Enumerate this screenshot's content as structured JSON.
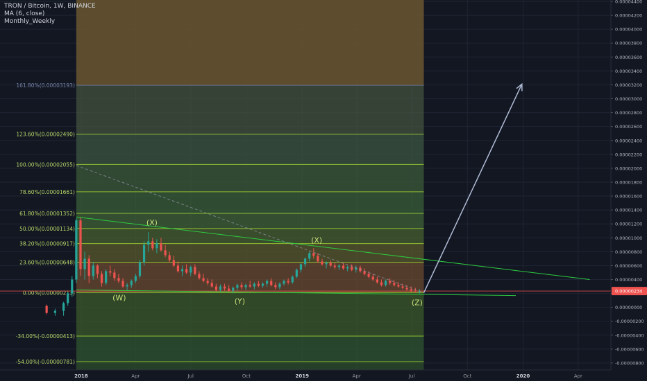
{
  "legend": {
    "title": "TRON / Bitcoin, 1W, BINANCE",
    "indicator1": "MA (6, close)",
    "indicator2": "Monthly_Weekly"
  },
  "colors": {
    "background": "#131722",
    "grid": "#1e2433",
    "up": "#26a69a",
    "down": "#ef5350",
    "fib": "#9acd32",
    "trend": "#2ecc40",
    "price_tag": "#ef5350",
    "arrow": "#b0bcd6"
  },
  "chart_data": {
    "type": "candlestick",
    "y_ticks": [
      "0.00004400",
      "0.00004200",
      "0.00004000",
      "0.00003800",
      "0.00003600",
      "0.00003400",
      "0.00003200",
      "0.00003000",
      "0.00002800",
      "0.00002600",
      "0.00002400",
      "0.00002200",
      "0.00002000",
      "0.00001800",
      "0.00001600",
      "0.00001400",
      "0.00001200",
      "0.00001000",
      "0.00000800",
      "0.00000600",
      "0.00000400",
      "0.00000200",
      "0.00000000",
      "-0.00000200",
      "-0.00000400",
      "-0.00000600",
      "-0.00000800"
    ],
    "ylim": [
      -9e-06,
      4.42e-05
    ],
    "x_ticks": [
      {
        "label": "2018",
        "date": "2018-01-01",
        "bold": true
      },
      {
        "label": "Apr",
        "date": "2018-04-01"
      },
      {
        "label": "Jul",
        "date": "2018-07-01"
      },
      {
        "label": "Oct",
        "date": "2018-10-01"
      },
      {
        "label": "2019",
        "date": "2019-01-01",
        "bold": true
      },
      {
        "label": "Apr",
        "date": "2019-04-01"
      },
      {
        "label": "Jul",
        "date": "2019-07-01"
      },
      {
        "label": "Oct",
        "date": "2019-10-01"
      },
      {
        "label": "2020",
        "date": "2020-01-01",
        "bold": true
      },
      {
        "label": "Apr",
        "date": "2020-04-01"
      }
    ],
    "xlim": [
      "2017-08-20",
      "2020-05-25"
    ],
    "last_price": "0.00000234",
    "last_price_value": 2.34e-06,
    "fib_range": [
      "2017-12-24",
      "2019-07-21"
    ],
    "fib_levels": [
      {
        "label": "161.80%(0.00003193)",
        "value": 3.193e-05
      },
      {
        "label": "123.60%(0.00002490)",
        "value": 2.49e-05
      },
      {
        "label": "100.00%(0.00002055)",
        "value": 2.055e-05
      },
      {
        "label": "78.60%(0.00001661)",
        "value": 1.661e-05
      },
      {
        "label": "61.80%(0.00001352)",
        "value": 1.352e-05
      },
      {
        "label": "50.00%(0.00001134)",
        "value": 1.134e-05
      },
      {
        "label": "38.20%(0.00000917)",
        "value": 9.17e-06
      },
      {
        "label": "23.60%(0.00000648)",
        "value": 6.48e-06
      },
      {
        "label": "0.00%(0.00000213)",
        "value": 2.13e-06
      },
      {
        "label": "-34.00%(-0.00000413)",
        "value": -4.13e-06
      },
      {
        "label": "-54.00%(-0.00000781)",
        "value": -7.81e-06
      }
    ],
    "wave_labels": [
      {
        "text": "(X)",
        "date": "2018-04-28",
        "value": 1.18e-05
      },
      {
        "text": "(W)",
        "date": "2018-03-05",
        "value": 1e-06
      },
      {
        "text": "(Y)",
        "date": "2018-09-20",
        "value": 5e-07
      },
      {
        "text": "(X)",
        "date": "2019-01-25",
        "value": 9.3e-06
      },
      {
        "text": "(Z)",
        "date": "2019-07-10",
        "value": 3e-07
      }
    ],
    "trendlines": [
      {
        "from": [
          "2017-12-24",
          1.3e-05
        ],
        "to": [
          "2020-04-20",
          4e-06
        ],
        "color": "trend"
      },
      {
        "from": [
          "2017-12-24",
          2.5e-06
        ],
        "to": [
          "2019-12-20",
          1.7e-06
        ],
        "color": "trend"
      },
      {
        "from": [
          "2017-12-24",
          2.04e-05
        ],
        "to": [
          "2019-07-21",
          2.1e-06
        ],
        "color": "dash"
      },
      {
        "from": [
          "2019-07-21",
          2.1e-06
        ],
        "to": [
          "2019-12-30",
          3.21e-05
        ],
        "color": "arrow"
      }
    ],
    "candles": [
      {
        "date": "2017-11-05",
        "o": 2e-07,
        "h": 4e-07,
        "l": -1e-06,
        "c": -8e-07
      },
      {
        "date": "2017-11-19",
        "o": -8e-07,
        "h": -2e-07,
        "l": -1.2e-06,
        "c": -5e-07
      },
      {
        "date": "2017-12-03",
        "o": -5e-07,
        "h": 8e-07,
        "l": -1.2e-06,
        "c": 6e-07
      },
      {
        "date": "2017-12-10",
        "o": 6e-07,
        "h": 2.2e-06,
        "l": 2e-07,
        "c": 2e-06
      },
      {
        "date": "2017-12-17",
        "o": 2e-06,
        "h": 4.5e-06,
        "l": 1.5e-06,
        "c": 4e-06
      },
      {
        "date": "2017-12-24",
        "o": 4e-06,
        "h": 1.28e-05,
        "l": 3.5e-06,
        "c": 1.25e-05
      },
      {
        "date": "2017-12-31",
        "o": 1.25e-05,
        "h": 1.3e-05,
        "l": 4.5e-06,
        "c": 5.5e-06
      },
      {
        "date": "2018-01-07",
        "o": 5.5e-06,
        "h": 8e-06,
        "l": 4e-06,
        "c": 7e-06
      },
      {
        "date": "2018-01-14",
        "o": 7e-06,
        "h": 7.5e-06,
        "l": 3.5e-06,
        "c": 4.5e-06
      },
      {
        "date": "2018-01-21",
        "o": 4.5e-06,
        "h": 6.5e-06,
        "l": 4e-06,
        "c": 6e-06
      },
      {
        "date": "2018-01-28",
        "o": 6e-06,
        "h": 6.2e-06,
        "l": 4.2e-06,
        "c": 4.8e-06
      },
      {
        "date": "2018-02-04",
        "o": 4.8e-06,
        "h": 5.2e-06,
        "l": 3e-06,
        "c": 3.5e-06
      },
      {
        "date": "2018-02-11",
        "o": 3.5e-06,
        "h": 5.5e-06,
        "l": 3.2e-06,
        "c": 5.2e-06
      },
      {
        "date": "2018-02-18",
        "o": 5.2e-06,
        "h": 6e-06,
        "l": 4.5e-06,
        "c": 5e-06
      },
      {
        "date": "2018-02-25",
        "o": 5e-06,
        "h": 5.5e-06,
        "l": 3.8e-06,
        "c": 4.2e-06
      },
      {
        "date": "2018-03-04",
        "o": 4.2e-06,
        "h": 4.8e-06,
        "l": 3.5e-06,
        "c": 3.8e-06
      },
      {
        "date": "2018-03-11",
        "o": 3.8e-06,
        "h": 4.2e-06,
        "l": 2.8e-06,
        "c": 3e-06
      },
      {
        "date": "2018-03-18",
        "o": 3e-06,
        "h": 3.5e-06,
        "l": 2.5e-06,
        "c": 3.2e-06
      },
      {
        "date": "2018-03-25",
        "o": 3.2e-06,
        "h": 4e-06,
        "l": 2.8e-06,
        "c": 3.8e-06
      },
      {
        "date": "2018-04-01",
        "o": 3.8e-06,
        "h": 4.8e-06,
        "l": 3.5e-06,
        "c": 4.5e-06
      },
      {
        "date": "2018-04-08",
        "o": 4.5e-06,
        "h": 6.8e-06,
        "l": 4.2e-06,
        "c": 6.5e-06
      },
      {
        "date": "2018-04-15",
        "o": 6.5e-06,
        "h": 9.5e-06,
        "l": 6e-06,
        "c": 9e-06
      },
      {
        "date": "2018-04-22",
        "o": 9e-06,
        "h": 1.08e-05,
        "l": 8e-06,
        "c": 9.5e-06
      },
      {
        "date": "2018-04-29",
        "o": 9.5e-06,
        "h": 1e-05,
        "l": 8.2e-06,
        "c": 8.5e-06
      },
      {
        "date": "2018-05-06",
        "o": 8.5e-06,
        "h": 9.8e-06,
        "l": 7.8e-06,
        "c": 9.2e-06
      },
      {
        "date": "2018-05-13",
        "o": 9.2e-06,
        "h": 1e-05,
        "l": 8e-06,
        "c": 8.2e-06
      },
      {
        "date": "2018-05-20",
        "o": 8.2e-06,
        "h": 9e-06,
        "l": 7.2e-06,
        "c": 7.5e-06
      },
      {
        "date": "2018-05-27",
        "o": 7.5e-06,
        "h": 8e-06,
        "l": 6.5e-06,
        "c": 6.8e-06
      },
      {
        "date": "2018-06-03",
        "o": 6.8e-06,
        "h": 7.4e-06,
        "l": 5.8e-06,
        "c": 6e-06
      },
      {
        "date": "2018-06-10",
        "o": 6e-06,
        "h": 6.6e-06,
        "l": 5e-06,
        "c": 5.2e-06
      },
      {
        "date": "2018-06-17",
        "o": 5.2e-06,
        "h": 6e-06,
        "l": 4.5e-06,
        "c": 5.5e-06
      },
      {
        "date": "2018-06-24",
        "o": 5.5e-06,
        "h": 6.2e-06,
        "l": 4.8e-06,
        "c": 5e-06
      },
      {
        "date": "2018-07-01",
        "o": 5e-06,
        "h": 6e-06,
        "l": 4.5e-06,
        "c": 5.8e-06
      },
      {
        "date": "2018-07-08",
        "o": 5.8e-06,
        "h": 6.2e-06,
        "l": 4.6e-06,
        "c": 4.8e-06
      },
      {
        "date": "2018-07-15",
        "o": 4.8e-06,
        "h": 5.2e-06,
        "l": 4e-06,
        "c": 4.2e-06
      },
      {
        "date": "2018-07-22",
        "o": 4.2e-06,
        "h": 4.8e-06,
        "l": 3.6e-06,
        "c": 3.8e-06
      },
      {
        "date": "2018-07-29",
        "o": 3.8e-06,
        "h": 4.2e-06,
        "l": 3.2e-06,
        "c": 3.5e-06
      },
      {
        "date": "2018-08-05",
        "o": 3.5e-06,
        "h": 4e-06,
        "l": 2.8e-06,
        "c": 3e-06
      },
      {
        "date": "2018-08-12",
        "o": 3e-06,
        "h": 3.4e-06,
        "l": 2.2e-06,
        "c": 2.5e-06
      },
      {
        "date": "2018-08-19",
        "o": 2.5e-06,
        "h": 3.3e-06,
        "l": 2.2e-06,
        "c": 3e-06
      },
      {
        "date": "2018-08-26",
        "o": 3e-06,
        "h": 3.4e-06,
        "l": 2.4e-06,
        "c": 2.7e-06
      },
      {
        "date": "2018-09-02",
        "o": 2.7e-06,
        "h": 3.2e-06,
        "l": 2.2e-06,
        "c": 2.4e-06
      },
      {
        "date": "2018-09-09",
        "o": 2.4e-06,
        "h": 3e-06,
        "l": 2e-06,
        "c": 2.8e-06
      },
      {
        "date": "2018-09-16",
        "o": 2.8e-06,
        "h": 3.4e-06,
        "l": 2.4e-06,
        "c": 3.2e-06
      },
      {
        "date": "2018-09-23",
        "o": 3.2e-06,
        "h": 3.6e-06,
        "l": 2.6e-06,
        "c": 2.9e-06
      },
      {
        "date": "2018-09-30",
        "o": 2.9e-06,
        "h": 3.4e-06,
        "l": 2.5e-06,
        "c": 3.2e-06
      },
      {
        "date": "2018-10-07",
        "o": 3.2e-06,
        "h": 3.8e-06,
        "l": 2.8e-06,
        "c": 3e-06
      },
      {
        "date": "2018-10-14",
        "o": 3e-06,
        "h": 3.6e-06,
        "l": 2.6e-06,
        "c": 3.4e-06
      },
      {
        "date": "2018-10-21",
        "o": 3.4e-06,
        "h": 3.8e-06,
        "l": 2.9e-06,
        "c": 3.1e-06
      },
      {
        "date": "2018-10-28",
        "o": 3.1e-06,
        "h": 3.6e-06,
        "l": 2.8e-06,
        "c": 3.4e-06
      },
      {
        "date": "2018-11-04",
        "o": 3.4e-06,
        "h": 4e-06,
        "l": 3e-06,
        "c": 3.8e-06
      },
      {
        "date": "2018-11-11",
        "o": 3.8e-06,
        "h": 4.2e-06,
        "l": 3e-06,
        "c": 3.2e-06
      },
      {
        "date": "2018-11-18",
        "o": 3.2e-06,
        "h": 3.6e-06,
        "l": 2.6e-06,
        "c": 2.9e-06
      },
      {
        "date": "2018-11-25",
        "o": 2.9e-06,
        "h": 3.6e-06,
        "l": 2.6e-06,
        "c": 3.4e-06
      },
      {
        "date": "2018-12-02",
        "o": 3.4e-06,
        "h": 4e-06,
        "l": 3.1e-06,
        "c": 3.8e-06
      },
      {
        "date": "2018-12-09",
        "o": 3.8e-06,
        "h": 4.2e-06,
        "l": 3.3e-06,
        "c": 3.6e-06
      },
      {
        "date": "2018-12-16",
        "o": 3.6e-06,
        "h": 4.6e-06,
        "l": 3.4e-06,
        "c": 4.4e-06
      },
      {
        "date": "2018-12-23",
        "o": 4.4e-06,
        "h": 5.6e-06,
        "l": 4.2e-06,
        "c": 5.4e-06
      },
      {
        "date": "2018-12-30",
        "o": 5.4e-06,
        "h": 6.4e-06,
        "l": 5e-06,
        "c": 6.2e-06
      },
      {
        "date": "2019-01-06",
        "o": 6.2e-06,
        "h": 7.2e-06,
        "l": 5.8e-06,
        "c": 7e-06
      },
      {
        "date": "2019-01-13",
        "o": 7e-06,
        "h": 8e-06,
        "l": 6.6e-06,
        "c": 7.8e-06
      },
      {
        "date": "2019-01-20",
        "o": 7.8e-06,
        "h": 8.5e-06,
        "l": 7e-06,
        "c": 7.4e-06
      },
      {
        "date": "2019-01-27",
        "o": 7.4e-06,
        "h": 7.8e-06,
        "l": 6.4e-06,
        "c": 6.6e-06
      },
      {
        "date": "2019-02-03",
        "o": 6.6e-06,
        "h": 7e-06,
        "l": 6e-06,
        "c": 6.2e-06
      },
      {
        "date": "2019-02-10",
        "o": 6.2e-06,
        "h": 6.6e-06,
        "l": 5.6e-06,
        "c": 6.4e-06
      },
      {
        "date": "2019-02-17",
        "o": 6.4e-06,
        "h": 6.8e-06,
        "l": 5.8e-06,
        "c": 6e-06
      },
      {
        "date": "2019-02-24",
        "o": 6e-06,
        "h": 6.4e-06,
        "l": 5.5e-06,
        "c": 5.8e-06
      },
      {
        "date": "2019-03-03",
        "o": 5.8e-06,
        "h": 6.2e-06,
        "l": 5.4e-06,
        "c": 6e-06
      },
      {
        "date": "2019-03-10",
        "o": 6e-06,
        "h": 6.4e-06,
        "l": 5.4e-06,
        "c": 5.6e-06
      },
      {
        "date": "2019-03-17",
        "o": 5.6e-06,
        "h": 6e-06,
        "l": 5.2e-06,
        "c": 5.8e-06
      },
      {
        "date": "2019-03-24",
        "o": 5.8e-06,
        "h": 6.2e-06,
        "l": 5.2e-06,
        "c": 5.4e-06
      },
      {
        "date": "2019-03-31",
        "o": 5.4e-06,
        "h": 6e-06,
        "l": 5e-06,
        "c": 5.7e-06
      },
      {
        "date": "2019-04-07",
        "o": 5.7e-06,
        "h": 6e-06,
        "l": 5e-06,
        "c": 5.2e-06
      },
      {
        "date": "2019-04-14",
        "o": 5.2e-06,
        "h": 5.6e-06,
        "l": 4.6e-06,
        "c": 4.8e-06
      },
      {
        "date": "2019-04-21",
        "o": 4.8e-06,
        "h": 5.2e-06,
        "l": 4.2e-06,
        "c": 4.4e-06
      },
      {
        "date": "2019-04-28",
        "o": 4.4e-06,
        "h": 4.8e-06,
        "l": 3.8e-06,
        "c": 4e-06
      },
      {
        "date": "2019-05-05",
        "o": 4e-06,
        "h": 4.4e-06,
        "l": 3.4e-06,
        "c": 3.6e-06
      },
      {
        "date": "2019-05-12",
        "o": 3.6e-06,
        "h": 4e-06,
        "l": 3e-06,
        "c": 3.2e-06
      },
      {
        "date": "2019-05-19",
        "o": 3.2e-06,
        "h": 4e-06,
        "l": 3e-06,
        "c": 3.8e-06
      },
      {
        "date": "2019-05-26",
        "o": 3.8e-06,
        "h": 4.2e-06,
        "l": 3.2e-06,
        "c": 3.5e-06
      },
      {
        "date": "2019-06-02",
        "o": 3.5e-06,
        "h": 3.9e-06,
        "l": 3e-06,
        "c": 3.2e-06
      },
      {
        "date": "2019-06-09",
        "o": 3.2e-06,
        "h": 3.6e-06,
        "l": 2.8e-06,
        "c": 3e-06
      },
      {
        "date": "2019-06-16",
        "o": 3e-06,
        "h": 3.4e-06,
        "l": 2.6e-06,
        "c": 2.8e-06
      },
      {
        "date": "2019-06-23",
        "o": 2.8e-06,
        "h": 3.2e-06,
        "l": 2.4e-06,
        "c": 2.6e-06
      },
      {
        "date": "2019-06-30",
        "o": 2.6e-06,
        "h": 3e-06,
        "l": 2.2e-06,
        "c": 2.4e-06
      },
      {
        "date": "2019-07-07",
        "o": 2.4e-06,
        "h": 2.8e-06,
        "l": 2.1e-06,
        "c": 2.3e-06
      },
      {
        "date": "2019-07-14",
        "o": 2.3e-06,
        "h": 2.6e-06,
        "l": 2e-06,
        "c": 2.3e-06
      }
    ]
  }
}
